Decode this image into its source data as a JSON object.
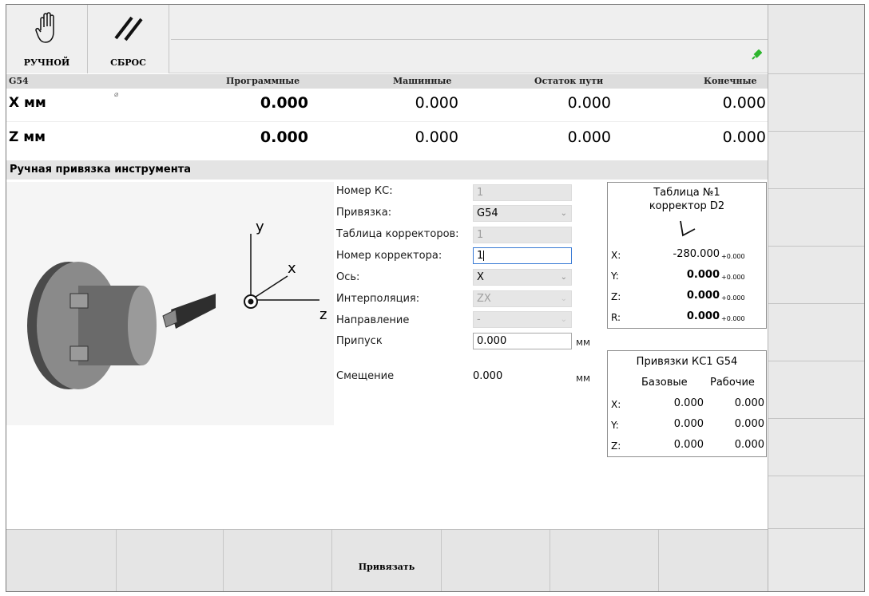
{
  "toolbar": {
    "mode_label": "РУЧНОЙ",
    "reset_label": "СБРОС"
  },
  "coords": {
    "wcs": "G54",
    "col_program": "Программные",
    "col_machine": "Машинные",
    "col_remaining": "Остаток пути",
    "col_final": "Конечные",
    "rows": [
      {
        "axis": "X мм",
        "program": "0.000",
        "machine": "0.000",
        "remaining": "0.000",
        "final": "0.000"
      },
      {
        "axis": "Z мм",
        "program": "0.000",
        "machine": "0.000",
        "remaining": "0.000",
        "final": "0.000"
      }
    ]
  },
  "section": {
    "title": "Ручная привязка инструмента"
  },
  "scene": {
    "label_y": "y",
    "label_x": "x",
    "label_z": "z"
  },
  "form": {
    "cs_number_label": "Номер КС:",
    "cs_number_value": "1",
    "binding_label": "Привязка:",
    "binding_value": "G54",
    "table_label": "Таблица корректоров:",
    "table_value": "1",
    "corrector_label": "Номер корректора:",
    "corrector_value": "1",
    "axis_label": "Ось:",
    "axis_value": "X",
    "interp_label": "Интерполяция:",
    "interp_value": "ZX",
    "direction_label": "Направление",
    "direction_value": "-",
    "allowance_label": "Припуск",
    "allowance_value": "0.000",
    "allowance_unit": "мм",
    "offset_label": "Смещение",
    "offset_value": "0.000",
    "offset_unit": "мм"
  },
  "corrector_box": {
    "title1": "Таблица №1",
    "title2": "корректор D2",
    "rows": [
      {
        "k": "X:",
        "v": "-280.000",
        "s": "+0.000"
      },
      {
        "k": "Y:",
        "v": "0.000",
        "s": "+0.000"
      },
      {
        "k": "Z:",
        "v": "0.000",
        "s": "+0.000"
      },
      {
        "k": "R:",
        "v": "0.000",
        "s": "+0.000"
      }
    ]
  },
  "binding_box": {
    "title": "Привязки КС1 G54",
    "col_base": "Базовые",
    "col_work": "Рабочие",
    "rows": [
      {
        "k": "X:",
        "base": "0.000",
        "work": "0.000"
      },
      {
        "k": "Y:",
        "base": "0.000",
        "work": "0.000"
      },
      {
        "k": "Z:",
        "base": "0.000",
        "work": "0.000"
      }
    ]
  },
  "softkeys": {
    "bind_label": "Привязать"
  },
  "colors": {
    "accent_green": "#2db52d",
    "focus_blue": "#3a7bd5"
  }
}
